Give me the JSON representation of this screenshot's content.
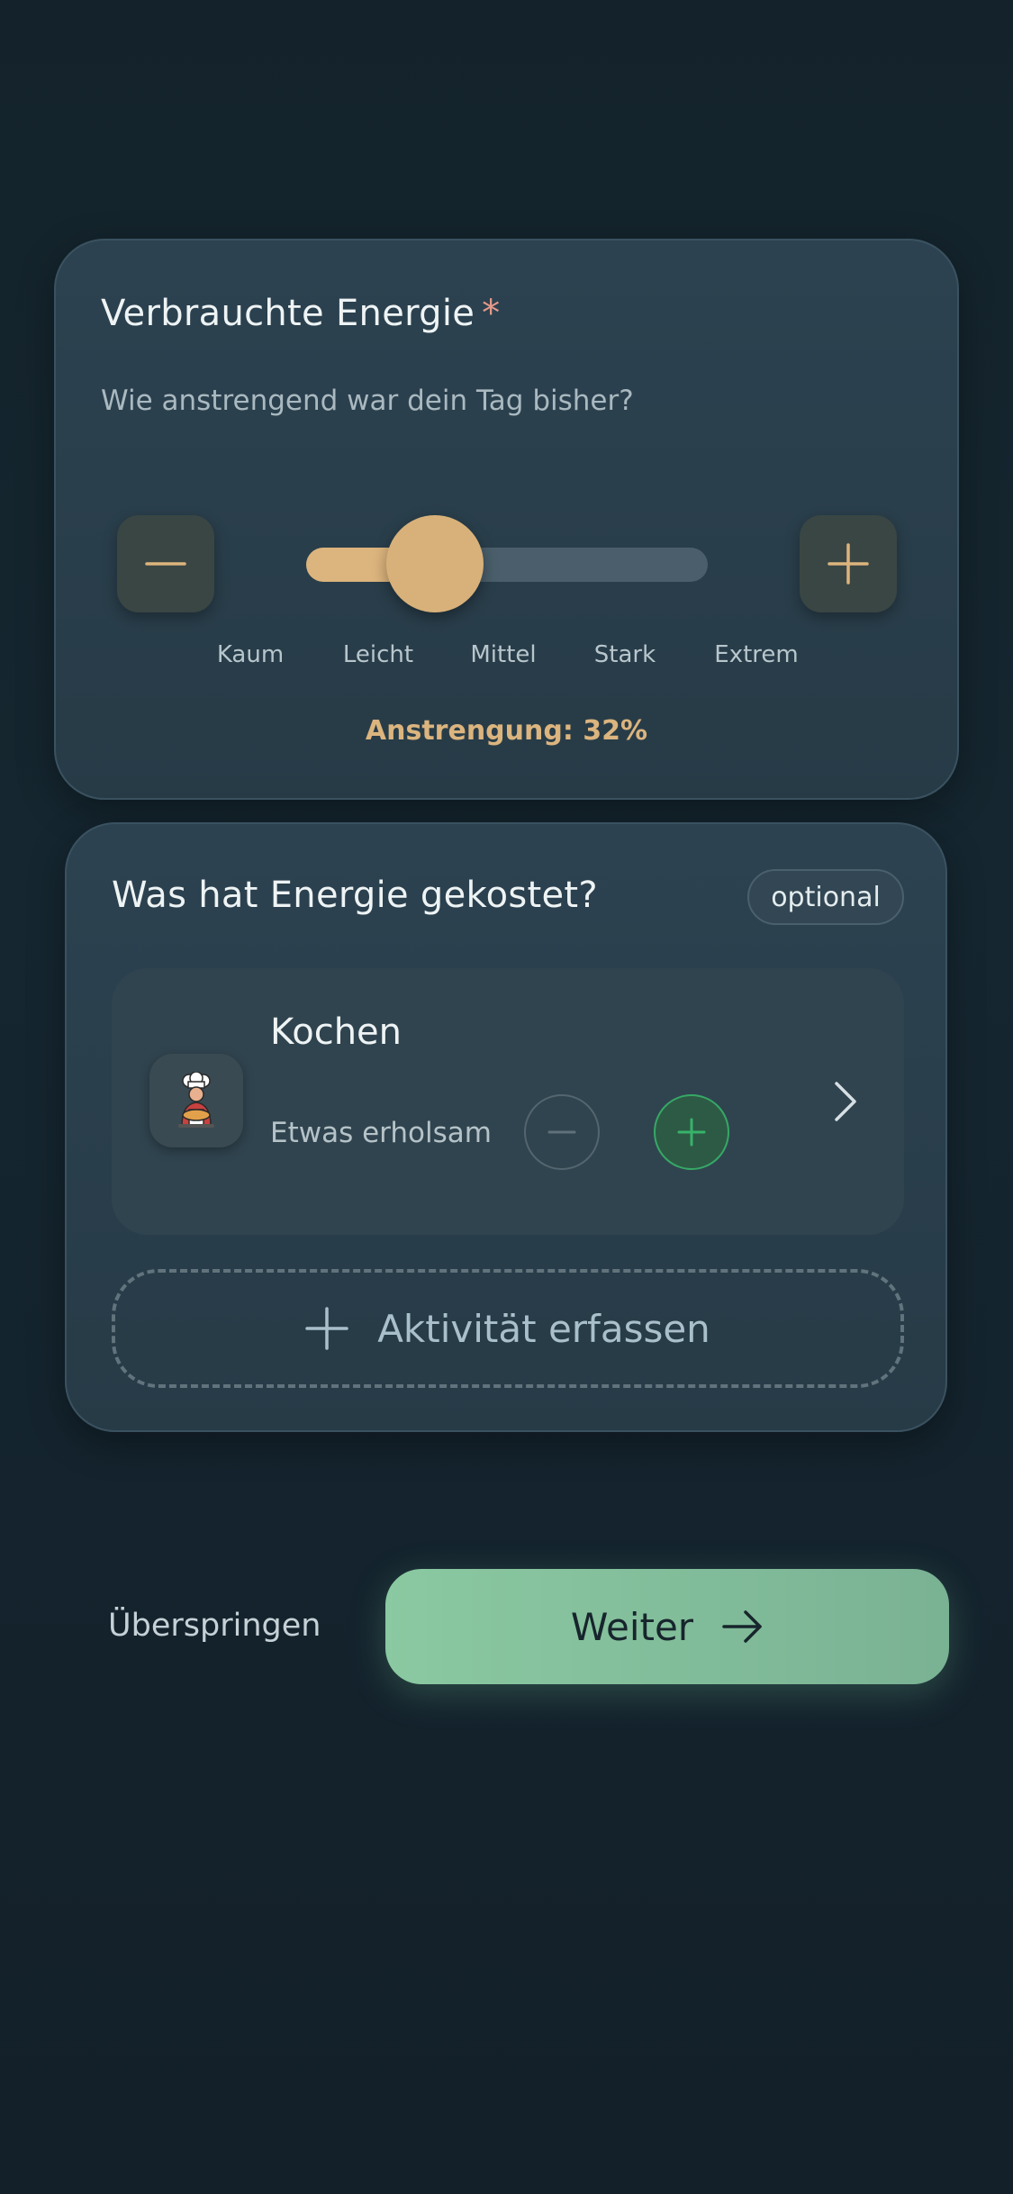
{
  "energy": {
    "title": "Verbrauchte Energie",
    "required_mark": "*",
    "question": "Wie anstrengend war dein Tag bisher?",
    "levels": [
      "Kaum",
      "Leicht",
      "Mittel",
      "Stark",
      "Extrem"
    ],
    "effort_fraction": 0.32,
    "effort_text": "Anstrengung: 32%",
    "minus_icon": "minus-icon",
    "plus_icon": "plus-icon",
    "accent_color": "#dcb47d"
  },
  "costs": {
    "title": "Was hat Energie gekostet?",
    "badge": "optional",
    "activities": [
      {
        "name": "Kochen",
        "level": "Etwas erholsam",
        "icon": "chef-icon"
      }
    ],
    "add_label": "Aktivität erfassen"
  },
  "footer": {
    "skip_label": "Überspringen",
    "next_label": "Weiter",
    "next_color": "#86c49e"
  }
}
